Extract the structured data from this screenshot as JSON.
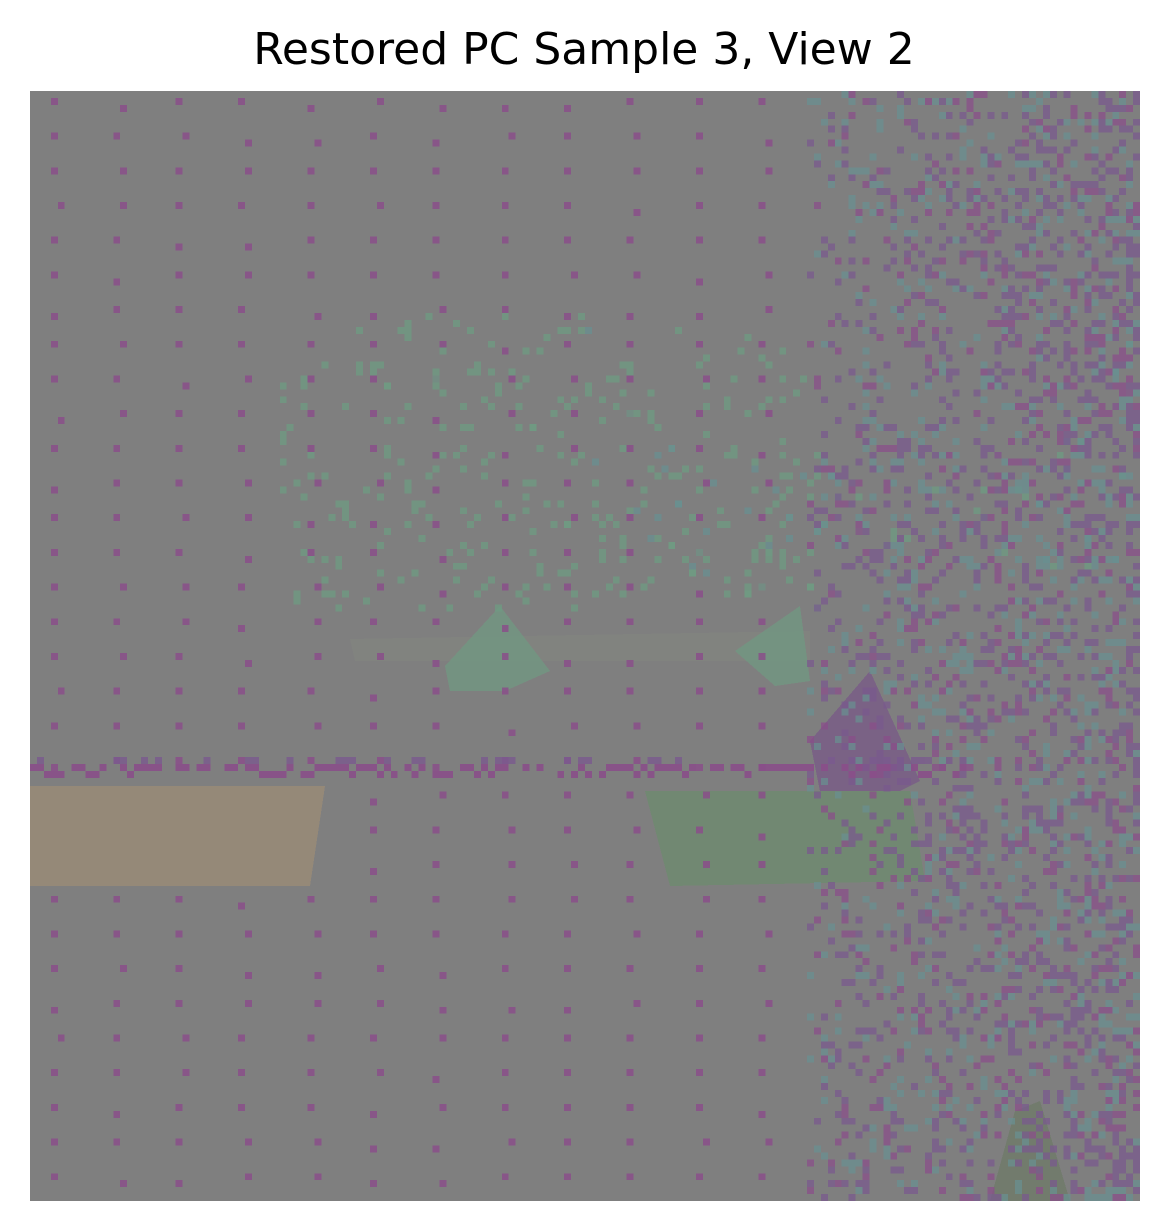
{
  "figure": {
    "title": "Restored PC Sample 3, View 2"
  },
  "image": {
    "grid_size": 160,
    "background_color": "#7f7f7f",
    "palette": {
      "magenta_point": "#8a4f8a",
      "violet_point": "#7a5a8e",
      "green_point": "#6f9a82",
      "teal_point": "#6a8f90",
      "tan_surface": "#978a78",
      "sage_surface": "#6e8a70",
      "purple_surface": "#7a5f86"
    }
  }
}
